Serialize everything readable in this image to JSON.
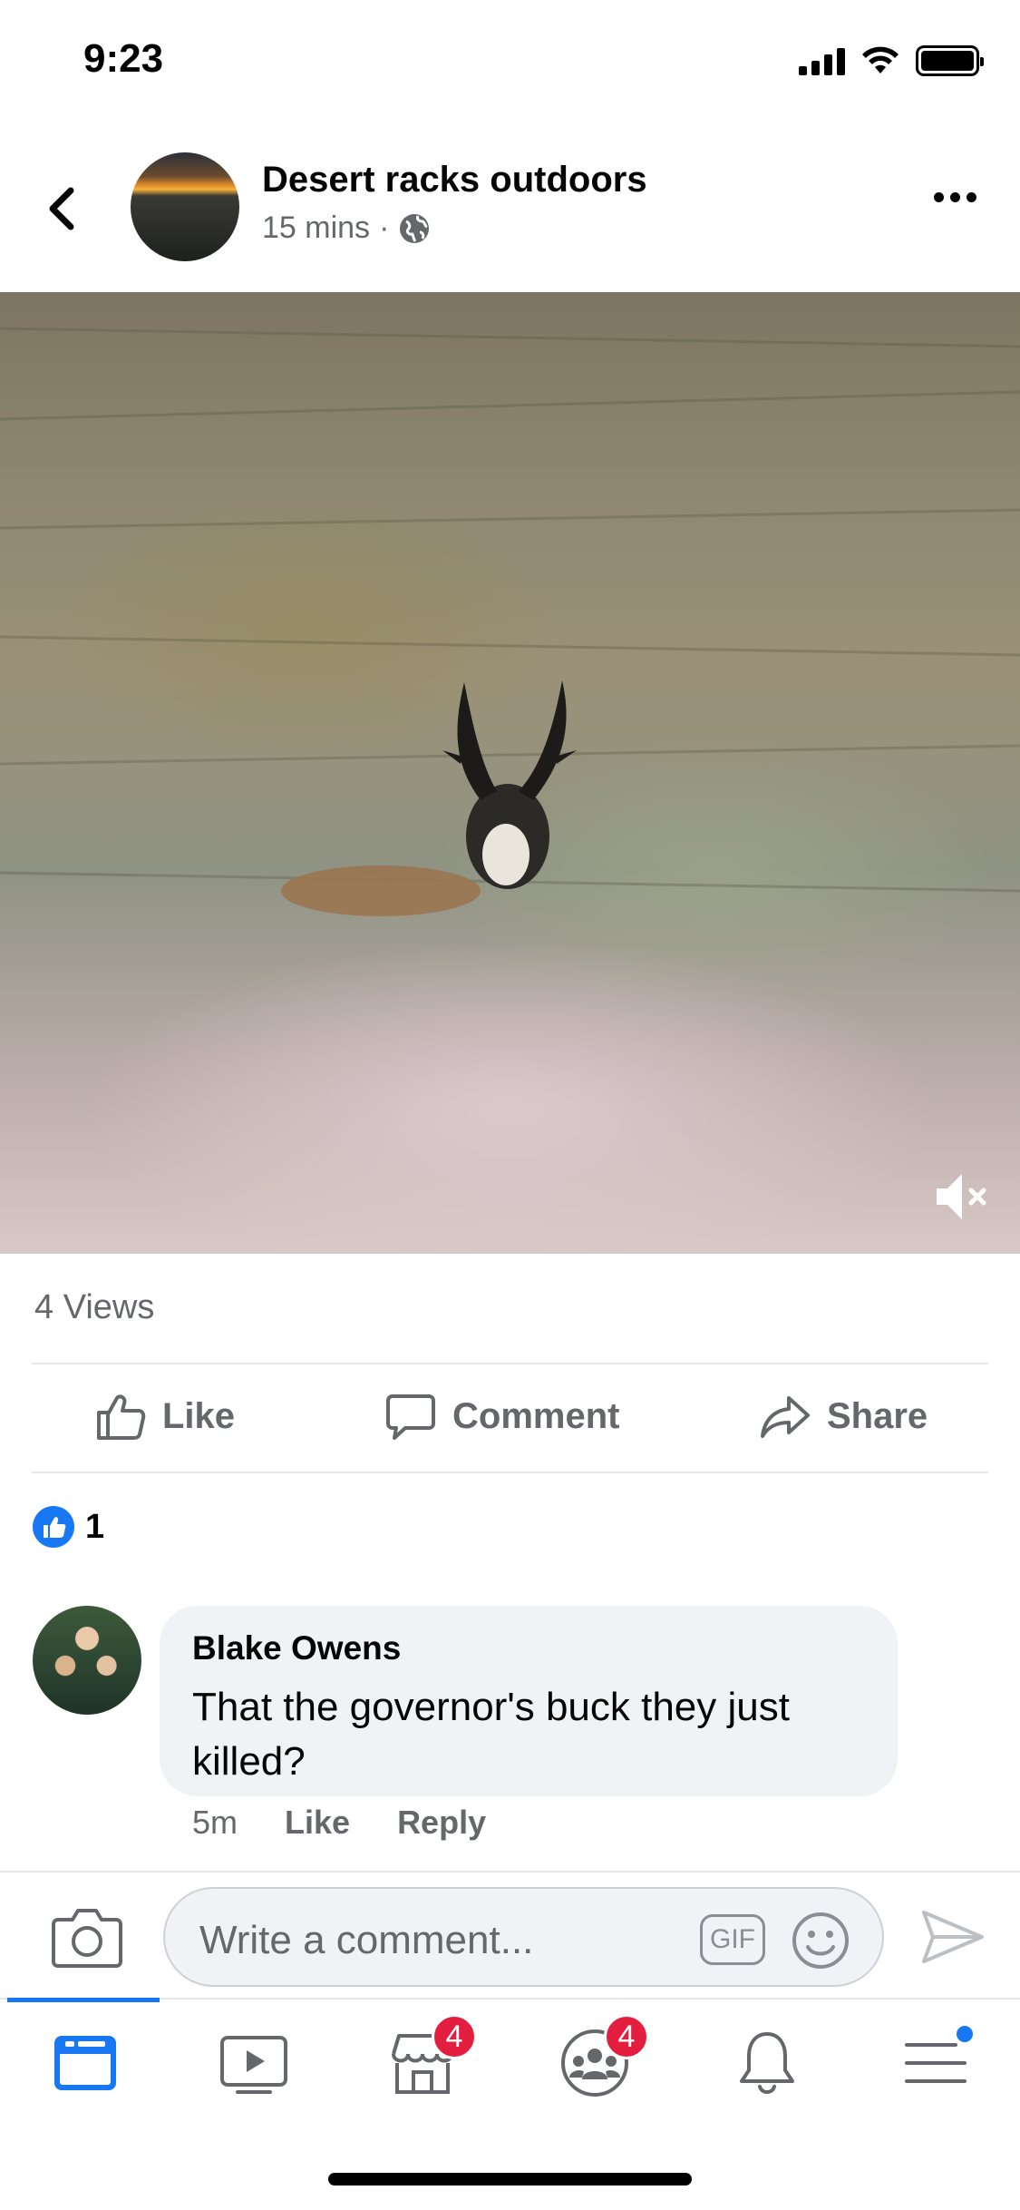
{
  "status_bar": {
    "time": "9:23"
  },
  "post": {
    "page_name": "Desert racks outdoors",
    "time": "15 mins",
    "separator": "·",
    "views": "4 Views"
  },
  "actions": {
    "like": "Like",
    "comment": "Comment",
    "share": "Share"
  },
  "reactions": {
    "count": "1"
  },
  "comment": {
    "author": "Blake Owens",
    "text": "That the governor's buck they just killed?",
    "time": "5m",
    "like": "Like",
    "reply": "Reply"
  },
  "composer": {
    "placeholder": "Write a comment...",
    "gif_label": "GIF"
  },
  "nav": {
    "items": [
      {
        "icon": "news-feed-icon",
        "active": true
      },
      {
        "icon": "watch-icon",
        "active": false
      },
      {
        "icon": "marketplace-icon",
        "active": false,
        "badge": "4"
      },
      {
        "icon": "groups-icon",
        "active": false,
        "badge": "4"
      },
      {
        "icon": "notifications-bell-icon",
        "active": false
      },
      {
        "icon": "menu-icon",
        "active": false
      }
    ]
  },
  "colors": {
    "accent": "#1877f2",
    "badge": "#e41e3f",
    "secondary_text": "#65676b"
  }
}
